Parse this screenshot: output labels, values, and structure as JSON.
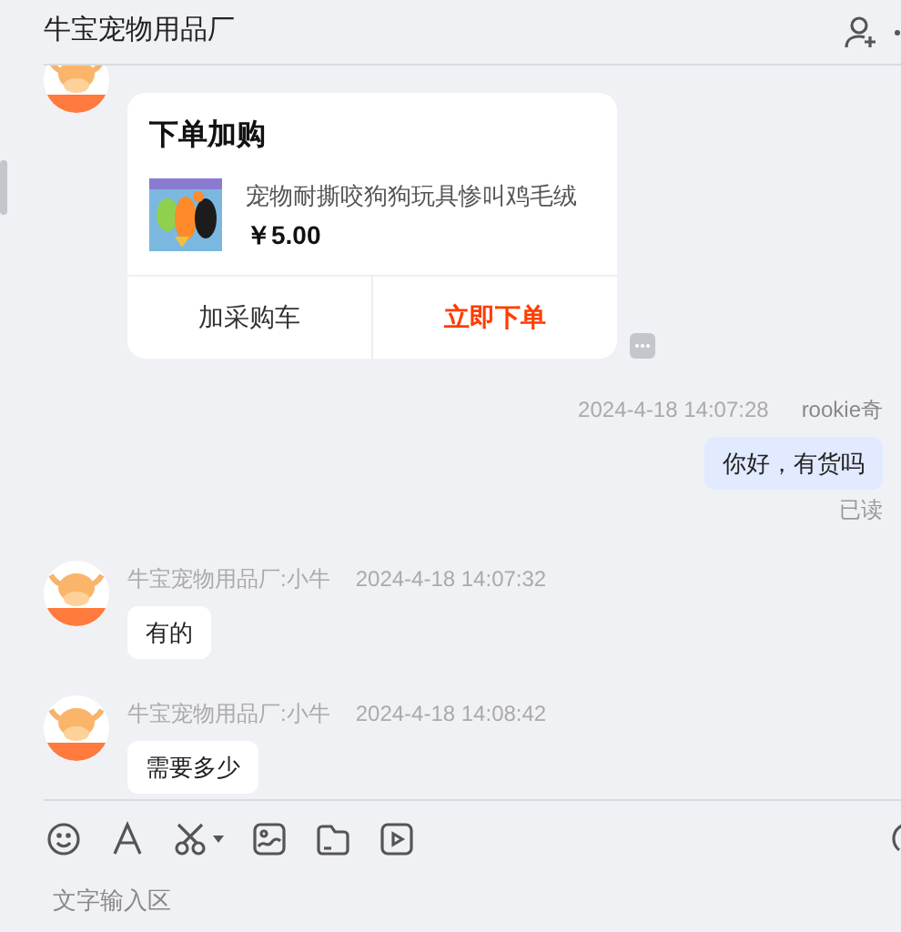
{
  "header": {
    "title": "牛宝宠物用品厂"
  },
  "messages": [
    {
      "kind": "card",
      "mine": false,
      "card": {
        "title": "下单加购",
        "product_name": "宠物耐撕咬狗狗玩具惨叫鸡毛绒",
        "price": "￥5.00",
        "buttons": [
          {
            "label": "加采购车",
            "kind": "secondary"
          },
          {
            "label": "立即下单",
            "kind": "primary"
          }
        ]
      }
    },
    {
      "kind": "text",
      "mine": true,
      "sender": "rookie奇",
      "time": "2024-4-18 14:07:28",
      "text": "你好，有货吗",
      "receipt": "已读"
    },
    {
      "kind": "text",
      "mine": false,
      "sender": "牛宝宠物用品厂:小牛",
      "time": "2024-4-18 14:07:32",
      "text": "有的"
    },
    {
      "kind": "text",
      "mine": false,
      "sender": "牛宝宠物用品厂:小牛",
      "time": "2024-4-18 14:08:42",
      "text": "需要多少"
    }
  ],
  "composer": {
    "placeholder": "文字输入区"
  }
}
